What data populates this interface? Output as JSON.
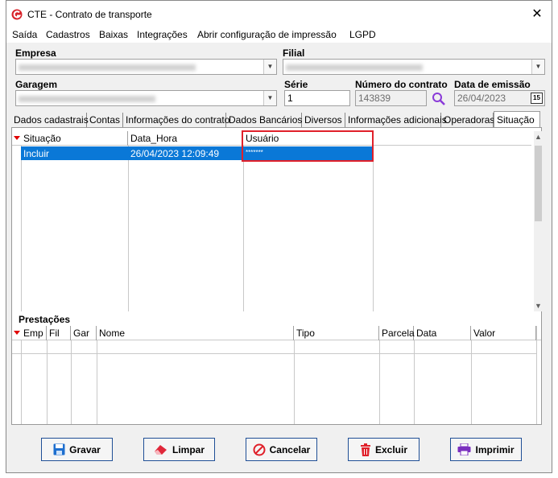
{
  "window": {
    "title": "CTE - Contrato de transporte",
    "close_glyph": "✕"
  },
  "menu": [
    "Saída",
    "Cadastros",
    "Baixas",
    "Integrações",
    "Abrir configuração de impressão",
    "LGPD"
  ],
  "form": {
    "empresa_label": "Empresa",
    "filial_label": "Filial",
    "garagem_label": "Garagem",
    "serie_label": "Série",
    "serie_value": "1",
    "numero_label": "Número do contrato",
    "numero_value": "143839",
    "data_label": "Data de emissão",
    "data_value": "26/04/2023",
    "calendar_icon_text": "15"
  },
  "tabs": [
    "Dados cadastrais",
    "Contas",
    "Informações do contrato",
    "Dados Bancários",
    "Diversos",
    "Informações adicionais",
    "Operadoras",
    "Situação"
  ],
  "active_tab": "Situação",
  "situacao_grid": {
    "columns": [
      "Situação",
      "Data_Hora",
      "Usuário"
    ],
    "rows": [
      {
        "situacao": "Incluir",
        "data_hora": "26/04/2023 12:09:49",
        "usuario": "*******"
      }
    ]
  },
  "prestacoes": {
    "label": "Prestações",
    "columns": [
      "Emp",
      "Fil",
      "Gar",
      "Nome",
      "Tipo",
      "Parcela",
      "Data",
      "Valor"
    ]
  },
  "buttons": {
    "gravar": "Gravar",
    "limpar": "Limpar",
    "cancelar": "Cancelar",
    "excluir": "Excluir",
    "imprimir": "Imprimir"
  },
  "colors": {
    "selection": "#0a78d7",
    "highlight_border": "#e0202a",
    "button_border": "#1f4f96",
    "sort_marker": "#e00000"
  }
}
